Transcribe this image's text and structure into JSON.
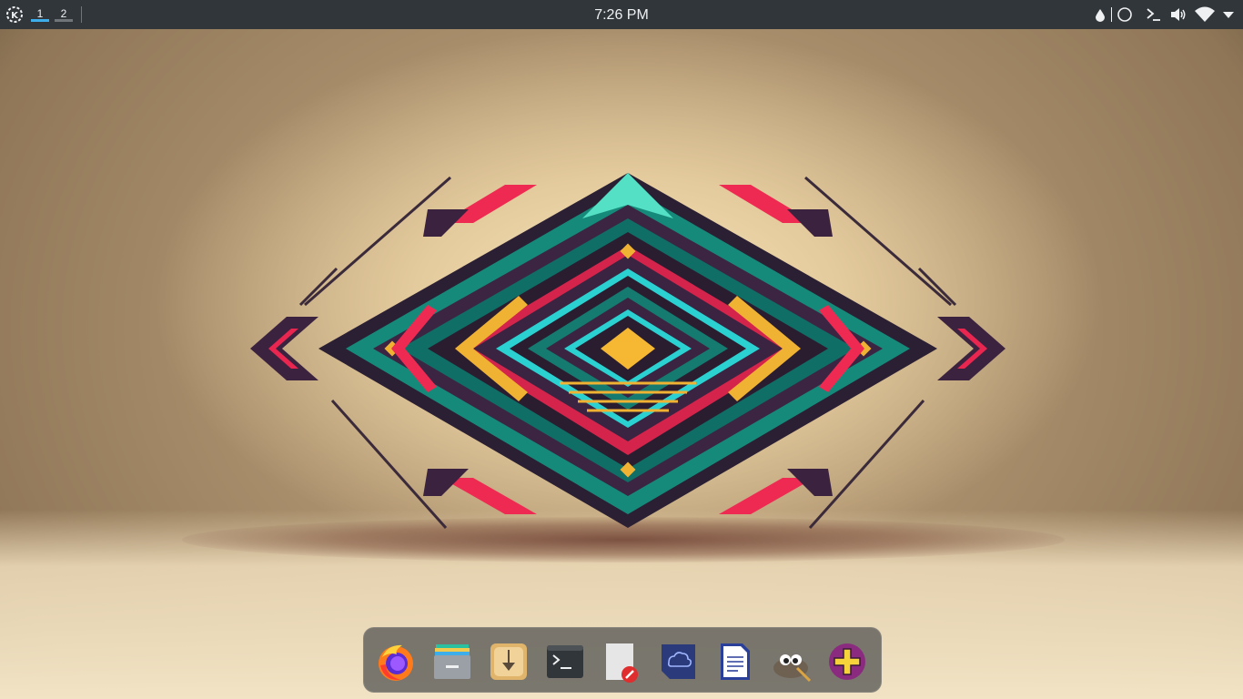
{
  "topbar": {
    "launcher_icon": "kde-logo-icon",
    "desktops": [
      {
        "label": "1",
        "active": true
      },
      {
        "label": "2",
        "active": false
      }
    ],
    "clock": "7:26 PM",
    "tray_icons": [
      "color-picker-icon",
      "night-mode-icon",
      "terminal-icon",
      "volume-icon",
      "wifi-icon",
      "chevron-down-icon"
    ],
    "colors": {
      "bar": "#31363b",
      "active_desktop": "#3daee9",
      "inactive_desktop": "#70757a"
    }
  },
  "dock": {
    "apps": [
      {
        "name": "firefox",
        "icon": "firefox-icon"
      },
      {
        "name": "files",
        "icon": "file-manager-icon"
      },
      {
        "name": "downloader",
        "icon": "download-icon"
      },
      {
        "name": "terminal",
        "icon": "terminal-icon"
      },
      {
        "name": "text-editor",
        "icon": "text-editor-icon"
      },
      {
        "name": "cloud",
        "icon": "cloud-icon"
      },
      {
        "name": "writer",
        "icon": "document-icon"
      },
      {
        "name": "gimp",
        "icon": "gimp-icon"
      },
      {
        "name": "add-applet",
        "icon": "plus-icon"
      }
    ]
  }
}
